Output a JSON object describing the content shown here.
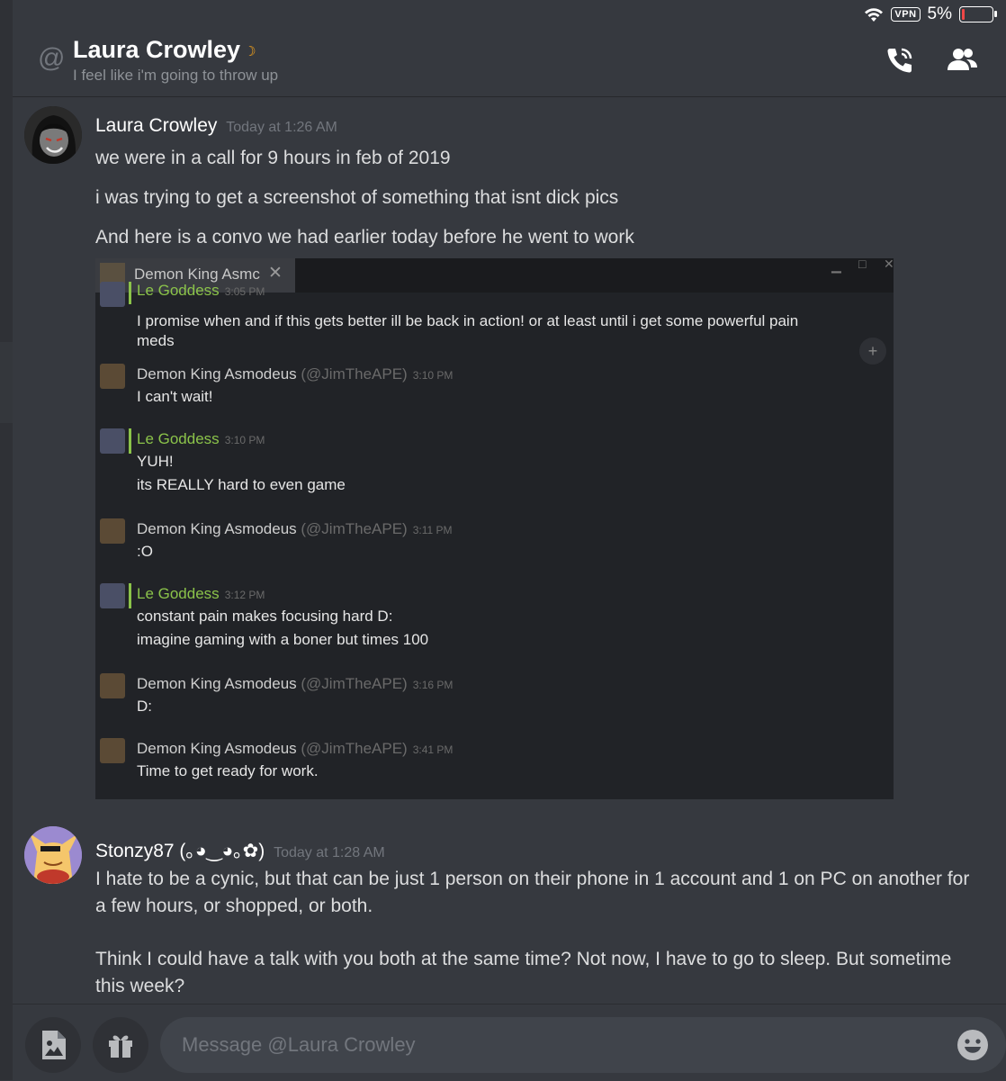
{
  "status_bar": {
    "vpn": "VPN",
    "battery": "5%"
  },
  "header": {
    "name": "Laura Crowley",
    "status_text": "I feel like i'm going to throw up"
  },
  "messages": [
    {
      "author": "Laura Crowley",
      "timestamp": "Today at 1:26 AM",
      "lines": [
        "we were in a call for 9 hours in feb of 2019",
        "i was trying to get a screenshot of something that isnt dick pics",
        "And here is a convo we  had earlier today before he went to work"
      ]
    },
    {
      "author": "Stonzy87 (｡◕‿◕｡✿)",
      "timestamp": "Today at 1:28 AM",
      "paragraphs": [
        "I hate to be a cynic, but that can be just 1 person on their phone in 1 account and 1 on PC on another for a few hours, or shopped, or both.",
        "Think I could have a talk with you both at the same time? Not now, I have to go to sleep. But sometime this week?"
      ]
    }
  ],
  "embed": {
    "tab_title": "Demon King Asmc",
    "top_fragment": {
      "name": "Le Goddess",
      "time": "3:05 PM"
    },
    "first_lines": [
      "I promise when and if this gets better ill be back in action! or at least until i get some powerful pain",
      "meds"
    ],
    "chat": [
      {
        "name": "Demon King Asmodeus",
        "handle": "(@JimTheAPE)",
        "time": "3:10 PM",
        "lines": [
          "I can't wait!"
        ]
      },
      {
        "name": "Le Goddess",
        "handle": "",
        "time": "3:10 PM",
        "lines": [
          "YUH!",
          "its REALLY hard to even game"
        ]
      },
      {
        "name": "Demon King Asmodeus",
        "handle": "(@JimTheAPE)",
        "time": "3:11 PM",
        "lines": [
          ":O"
        ]
      },
      {
        "name": "Le Goddess",
        "handle": "",
        "time": "3:12 PM",
        "lines": [
          "constant pain makes focusing hard D:",
          "imagine gaming with a boner but times 100"
        ]
      },
      {
        "name": "Demon King Asmodeus",
        "handle": "(@JimTheAPE)",
        "time": "3:16 PM",
        "lines": [
          "D:"
        ]
      },
      {
        "name": "Demon King Asmodeus",
        "handle": "(@JimTheAPE)",
        "time": "3:41 PM",
        "lines": [
          "Time to get ready for work."
        ]
      }
    ]
  },
  "composer": {
    "placeholder": "Message @Laura Crowley"
  },
  "icons": [
    "wifi-icon",
    "battery-icon",
    "at-icon",
    "moon-icon",
    "call-icon",
    "members-icon",
    "add-friend-icon",
    "image-upload-icon",
    "gift-icon",
    "emoji-icon"
  ],
  "colors": {
    "background": "#36393f",
    "idle": "#faa61a",
    "green_name": "#8bc34a",
    "battery_low": "#f04747"
  }
}
